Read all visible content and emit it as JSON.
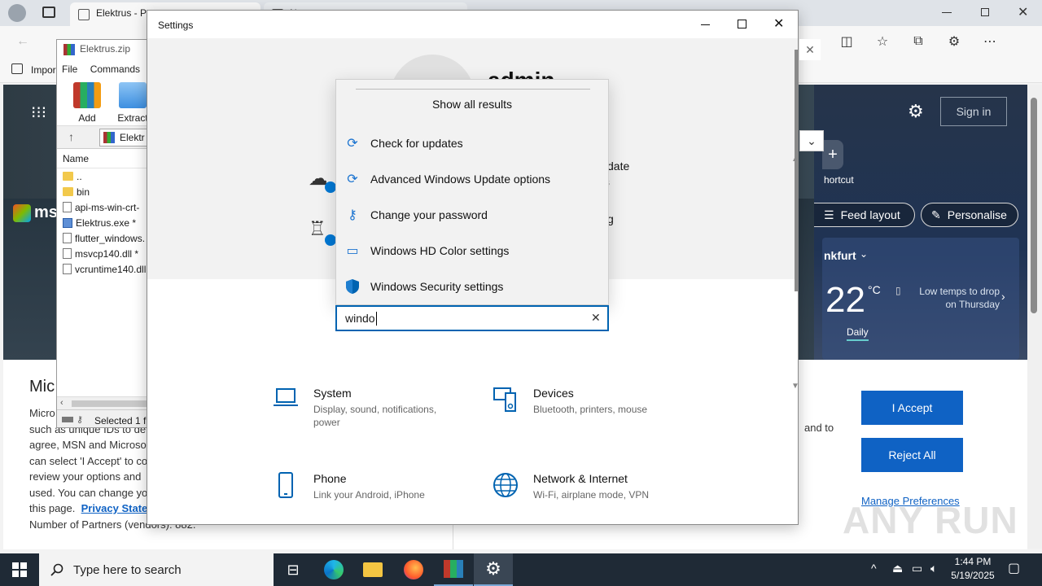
{
  "edge": {
    "tabs": [
      {
        "label": "Elektrus - P"
      },
      {
        "label": "N"
      }
    ],
    "favbar_item": "Impor",
    "sign_in": "Sign in",
    "feed_layout": "Feed layout",
    "personalise": "Personalise",
    "shortcut_label": "hortcut",
    "msn_logo": "ms",
    "weather": {
      "city": "nkfurt",
      "temp": "22",
      "unit": "°C",
      "alert": "Low temps to drop on Thursday",
      "tab": "Daily"
    },
    "consent": {
      "heading": "Mic",
      "lines": [
        "Micro",
        "such as unique IDs to de",
        "agree, MSN and Microso",
        "can select 'I Accept' to co",
        "review your options and",
        "used. You can change yo",
        "this page."
      ],
      "privacy_link": "Privacy State",
      "partners": "Number of Partners (vendors): 882.",
      "right_fragment": "and to",
      "accept": "I Accept",
      "reject": "Reject All",
      "manage": "Manage Preferences"
    }
  },
  "winrar": {
    "title": "Elektrus.zip",
    "menu": [
      "File",
      "Commands"
    ],
    "tools": [
      {
        "label": "Add"
      },
      {
        "label": "Extract"
      }
    ],
    "path": "Elektr",
    "column_name": "Name",
    "files": [
      {
        "name": "..",
        "type": "folder"
      },
      {
        "name": "bin",
        "type": "folder"
      },
      {
        "name": "api-ms-win-crt-",
        "type": "file"
      },
      {
        "name": "Elektrus.exe *",
        "type": "exe"
      },
      {
        "name": "flutter_windows.",
        "type": "file"
      },
      {
        "name": "msvcp140.dll *",
        "type": "file"
      },
      {
        "name": "vcruntime140.dll",
        "type": "file"
      }
    ],
    "status": "Selected 1 fi"
  },
  "settings": {
    "title": "Settings",
    "account_name": "admin",
    "behind_text": {
      "update": "date",
      "update2": "s",
      "other": "g"
    },
    "search": {
      "value": "windo",
      "show_all": "Show all results",
      "results": [
        {
          "label": "Check for updates",
          "icon": "refresh-icon"
        },
        {
          "label": "Advanced Windows Update options",
          "icon": "refresh-icon"
        },
        {
          "label": "Change your password",
          "icon": "key-icon"
        },
        {
          "label": "Windows HD Color settings",
          "icon": "display-icon"
        },
        {
          "label": "Windows Security settings",
          "icon": "shield-icon"
        }
      ]
    },
    "categories": [
      {
        "title": "System",
        "desc": "Display, sound, notifications, power",
        "icon": "laptop-icon"
      },
      {
        "title": "Devices",
        "desc": "Bluetooth, printers, mouse",
        "icon": "devices-icon"
      },
      {
        "title": "Phone",
        "desc": "Link your Android, iPhone",
        "icon": "phone-icon"
      },
      {
        "title": "Network & Internet",
        "desc": "Wi-Fi, airplane mode, VPN",
        "icon": "globe-icon"
      }
    ]
  },
  "taskbar": {
    "search_placeholder": "Type here to search",
    "time": "1:44 PM",
    "date": "5/19/2025"
  },
  "watermark": "ANY RUN",
  "colors": {
    "accent": "#0063b1",
    "consent_button": "#0f62c4",
    "taskbar": "#1f2a36"
  }
}
